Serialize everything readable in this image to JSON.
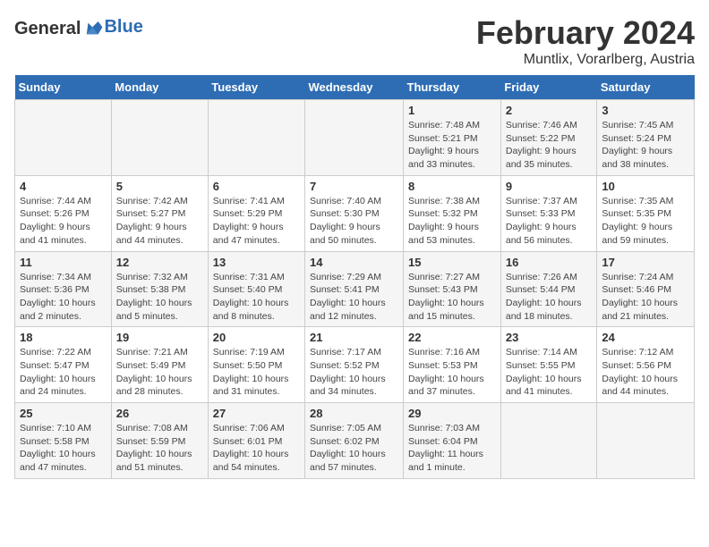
{
  "header": {
    "logo_general": "General",
    "logo_blue": "Blue",
    "title": "February 2024",
    "subtitle": "Muntlix, Vorarlberg, Austria"
  },
  "calendar": {
    "days_of_week": [
      "Sunday",
      "Monday",
      "Tuesday",
      "Wednesday",
      "Thursday",
      "Friday",
      "Saturday"
    ],
    "weeks": [
      [
        {
          "day": "",
          "detail": ""
        },
        {
          "day": "",
          "detail": ""
        },
        {
          "day": "",
          "detail": ""
        },
        {
          "day": "",
          "detail": ""
        },
        {
          "day": "1",
          "detail": "Sunrise: 7:48 AM\nSunset: 5:21 PM\nDaylight: 9 hours and 33 minutes."
        },
        {
          "day": "2",
          "detail": "Sunrise: 7:46 AM\nSunset: 5:22 PM\nDaylight: 9 hours and 35 minutes."
        },
        {
          "day": "3",
          "detail": "Sunrise: 7:45 AM\nSunset: 5:24 PM\nDaylight: 9 hours and 38 minutes."
        }
      ],
      [
        {
          "day": "4",
          "detail": "Sunrise: 7:44 AM\nSunset: 5:26 PM\nDaylight: 9 hours and 41 minutes."
        },
        {
          "day": "5",
          "detail": "Sunrise: 7:42 AM\nSunset: 5:27 PM\nDaylight: 9 hours and 44 minutes."
        },
        {
          "day": "6",
          "detail": "Sunrise: 7:41 AM\nSunset: 5:29 PM\nDaylight: 9 hours and 47 minutes."
        },
        {
          "day": "7",
          "detail": "Sunrise: 7:40 AM\nSunset: 5:30 PM\nDaylight: 9 hours and 50 minutes."
        },
        {
          "day": "8",
          "detail": "Sunrise: 7:38 AM\nSunset: 5:32 PM\nDaylight: 9 hours and 53 minutes."
        },
        {
          "day": "9",
          "detail": "Sunrise: 7:37 AM\nSunset: 5:33 PM\nDaylight: 9 hours and 56 minutes."
        },
        {
          "day": "10",
          "detail": "Sunrise: 7:35 AM\nSunset: 5:35 PM\nDaylight: 9 hours and 59 minutes."
        }
      ],
      [
        {
          "day": "11",
          "detail": "Sunrise: 7:34 AM\nSunset: 5:36 PM\nDaylight: 10 hours and 2 minutes."
        },
        {
          "day": "12",
          "detail": "Sunrise: 7:32 AM\nSunset: 5:38 PM\nDaylight: 10 hours and 5 minutes."
        },
        {
          "day": "13",
          "detail": "Sunrise: 7:31 AM\nSunset: 5:40 PM\nDaylight: 10 hours and 8 minutes."
        },
        {
          "day": "14",
          "detail": "Sunrise: 7:29 AM\nSunset: 5:41 PM\nDaylight: 10 hours and 12 minutes."
        },
        {
          "day": "15",
          "detail": "Sunrise: 7:27 AM\nSunset: 5:43 PM\nDaylight: 10 hours and 15 minutes."
        },
        {
          "day": "16",
          "detail": "Sunrise: 7:26 AM\nSunset: 5:44 PM\nDaylight: 10 hours and 18 minutes."
        },
        {
          "day": "17",
          "detail": "Sunrise: 7:24 AM\nSunset: 5:46 PM\nDaylight: 10 hours and 21 minutes."
        }
      ],
      [
        {
          "day": "18",
          "detail": "Sunrise: 7:22 AM\nSunset: 5:47 PM\nDaylight: 10 hours and 24 minutes."
        },
        {
          "day": "19",
          "detail": "Sunrise: 7:21 AM\nSunset: 5:49 PM\nDaylight: 10 hours and 28 minutes."
        },
        {
          "day": "20",
          "detail": "Sunrise: 7:19 AM\nSunset: 5:50 PM\nDaylight: 10 hours and 31 minutes."
        },
        {
          "day": "21",
          "detail": "Sunrise: 7:17 AM\nSunset: 5:52 PM\nDaylight: 10 hours and 34 minutes."
        },
        {
          "day": "22",
          "detail": "Sunrise: 7:16 AM\nSunset: 5:53 PM\nDaylight: 10 hours and 37 minutes."
        },
        {
          "day": "23",
          "detail": "Sunrise: 7:14 AM\nSunset: 5:55 PM\nDaylight: 10 hours and 41 minutes."
        },
        {
          "day": "24",
          "detail": "Sunrise: 7:12 AM\nSunset: 5:56 PM\nDaylight: 10 hours and 44 minutes."
        }
      ],
      [
        {
          "day": "25",
          "detail": "Sunrise: 7:10 AM\nSunset: 5:58 PM\nDaylight: 10 hours and 47 minutes."
        },
        {
          "day": "26",
          "detail": "Sunrise: 7:08 AM\nSunset: 5:59 PM\nDaylight: 10 hours and 51 minutes."
        },
        {
          "day": "27",
          "detail": "Sunrise: 7:06 AM\nSunset: 6:01 PM\nDaylight: 10 hours and 54 minutes."
        },
        {
          "day": "28",
          "detail": "Sunrise: 7:05 AM\nSunset: 6:02 PM\nDaylight: 10 hours and 57 minutes."
        },
        {
          "day": "29",
          "detail": "Sunrise: 7:03 AM\nSunset: 6:04 PM\nDaylight: 11 hours and 1 minute."
        },
        {
          "day": "",
          "detail": ""
        },
        {
          "day": "",
          "detail": ""
        }
      ]
    ]
  }
}
